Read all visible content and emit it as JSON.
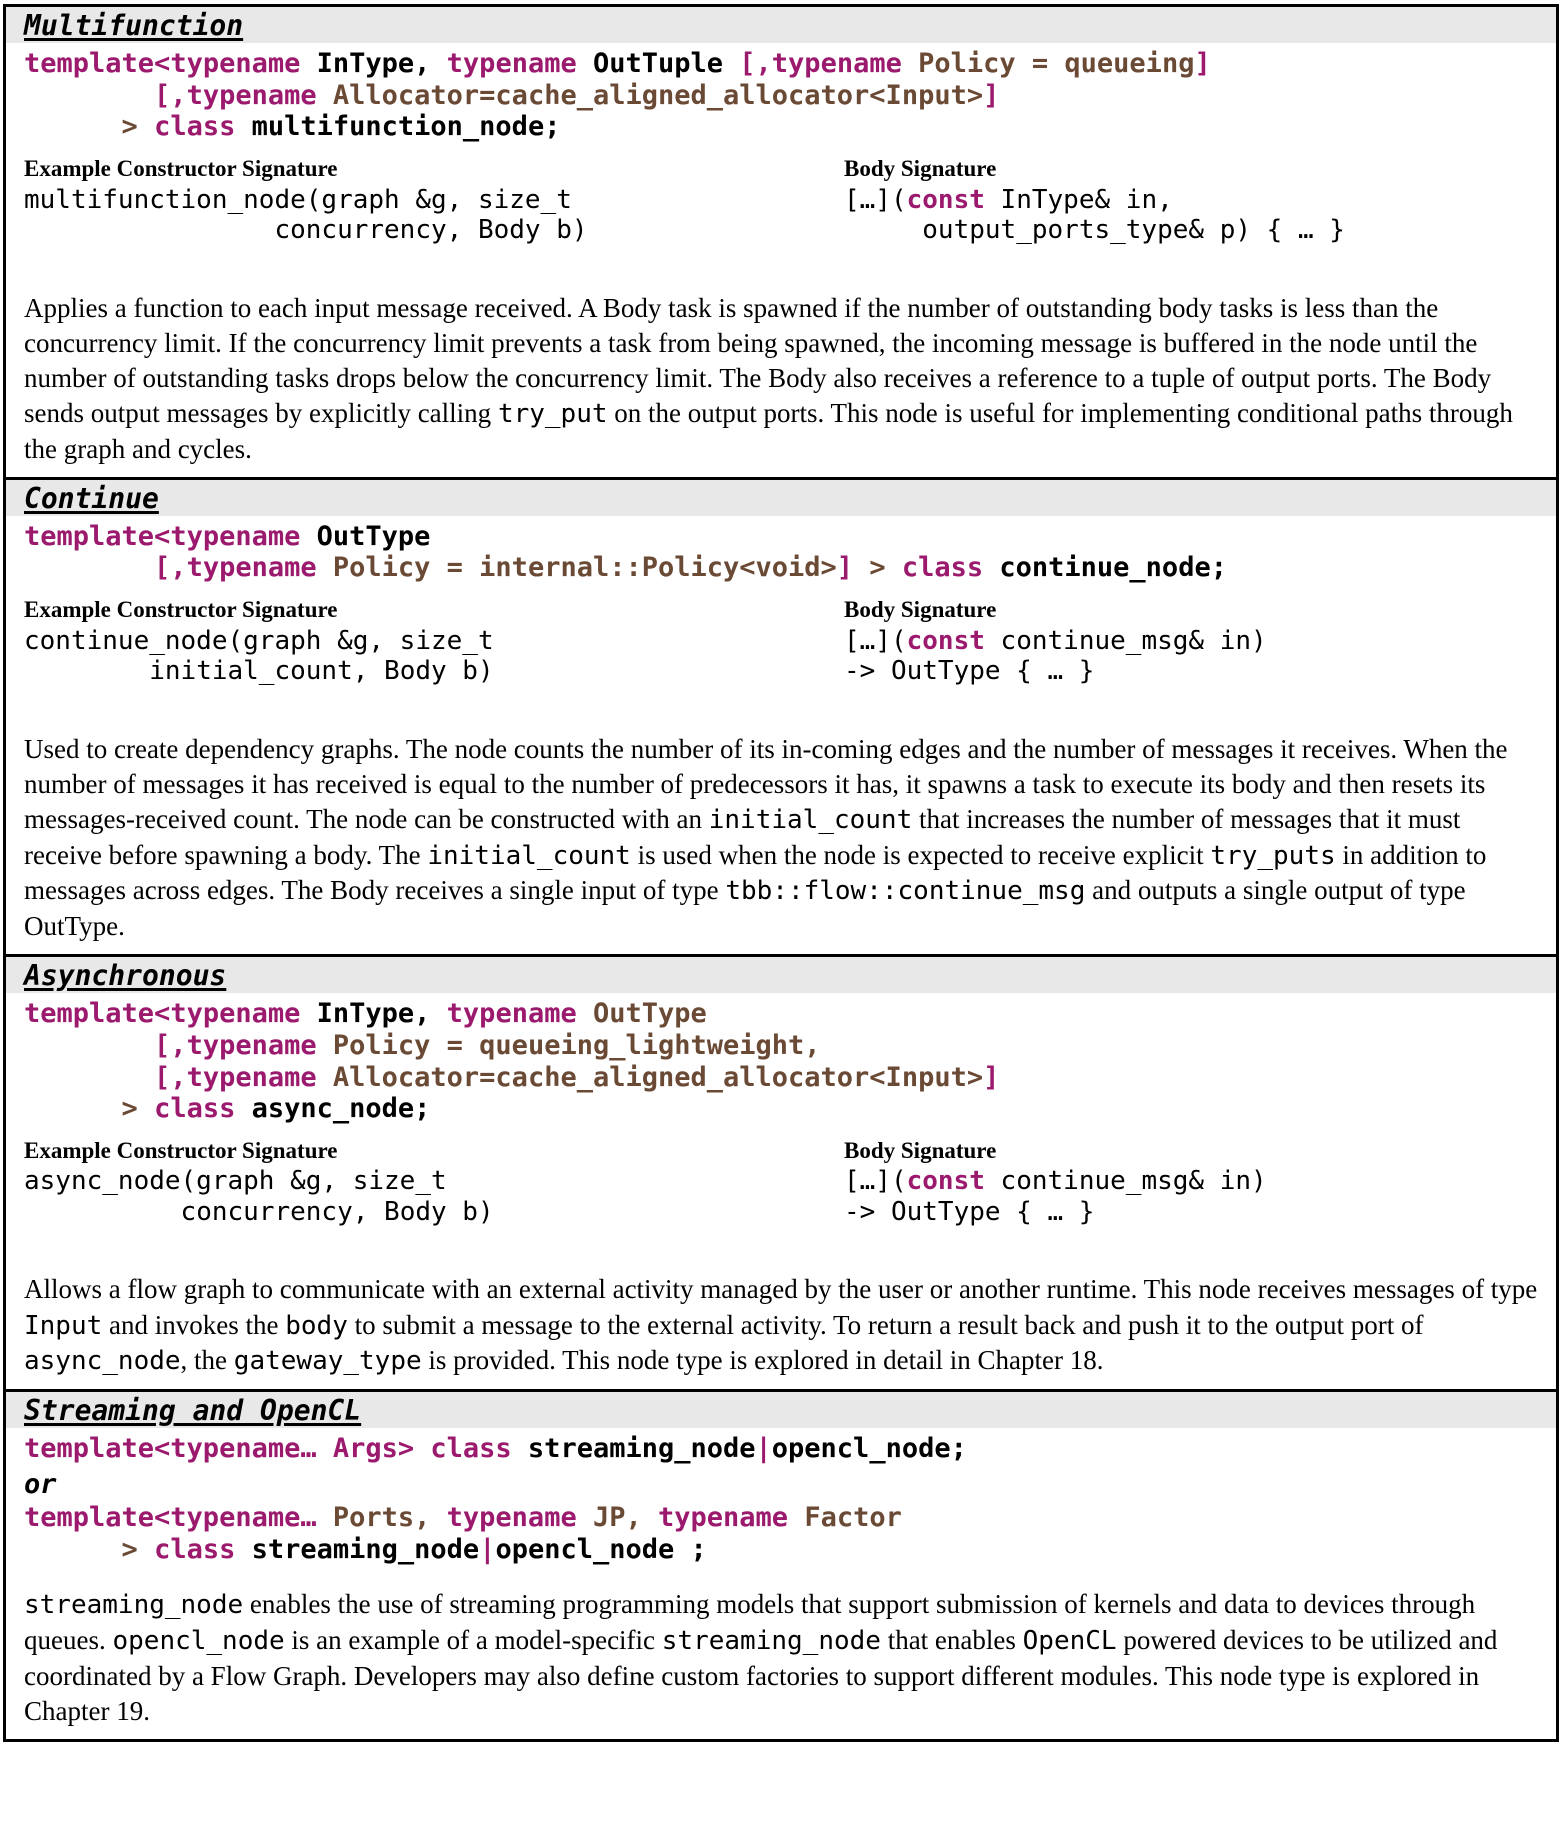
{
  "document": {
    "kind": "reference-table",
    "colors": {
      "keyword": "#9c1a6e",
      "default_value": "#6b4a35",
      "plain": "#000000",
      "header_band": "#e8e8e8",
      "border": "#000000"
    },
    "labels": {
      "constructor_signature": "Example Constructor Signature",
      "body_signature": "Body Signature",
      "or_separator": "or"
    }
  },
  "sections": [
    {
      "id": "multifunction",
      "title": "Multifunction",
      "template": {
        "lines": [
          [
            {
              "t": "template<",
              "c": "kw"
            },
            {
              "t": "typename",
              "c": "kw"
            },
            {
              "t": " InType, ",
              "c": "blk"
            },
            {
              "t": "typename",
              "c": "kw"
            },
            {
              "t": " OutTuple ",
              "c": "blk"
            },
            {
              "t": "[,",
              "c": "kw"
            },
            {
              "t": "typename",
              "c": "kw"
            },
            {
              "t": " ",
              "c": "blk"
            },
            {
              "t": "Policy = queueing",
              "c": "brn"
            },
            {
              "t": "]",
              "c": "kw"
            }
          ],
          [
            {
              "t": "        ",
              "c": "blk"
            },
            {
              "t": "[,",
              "c": "kw"
            },
            {
              "t": "typename",
              "c": "kw"
            },
            {
              "t": " ",
              "c": "blk"
            },
            {
              "t": "Allocator=cache_aligned_allocator<Input>",
              "c": "brn"
            },
            {
              "t": "]",
              "c": "kw"
            }
          ],
          [
            {
              "t": "      > ",
              "c": "brn"
            },
            {
              "t": "class",
              "c": "kw"
            },
            {
              "t": " multifunction_node;",
              "c": "blk"
            }
          ]
        ]
      },
      "constructor_signature": {
        "lines": [
          [
            {
              "t": "multifunction_node(graph &g, size_t",
              "c": "blk"
            }
          ],
          [
            {
              "t": "                concurrency, Body b)",
              "c": "blk"
            }
          ]
        ]
      },
      "body_signature": {
        "lines": [
          [
            {
              "t": "[…](",
              "c": "blk"
            },
            {
              "t": "const",
              "c": "kw"
            },
            {
              "t": " InType& in,",
              "c": "blk"
            }
          ],
          [
            {
              "t": "     output_ports_type& p) { … }",
              "c": "blk"
            }
          ]
        ]
      },
      "description": [
        {
          "t": "Applies a function to each input message received. A Body task is spawned if the number of outstanding body tasks is less than the concurrency limit.   If the concurrency limit prevents a task from being spawned, the incoming message is buffered in the node until the number of outstanding tasks drops below the concurrency limit. The Body also receives a reference to a tuple of output ports. The Body sends output messages by explicitly calling ",
          "m": false
        },
        {
          "t": "try_put",
          "m": true
        },
        {
          "t": "  on the output ports. This node is useful for implementing conditional paths through the graph and cycles.",
          "m": false
        }
      ]
    },
    {
      "id": "continue",
      "title": "Continue",
      "template": {
        "lines": [
          [
            {
              "t": "template<",
              "c": "kw"
            },
            {
              "t": "typename",
              "c": "kw"
            },
            {
              "t": " OutType",
              "c": "blk"
            }
          ],
          [
            {
              "t": "        ",
              "c": "blk"
            },
            {
              "t": "[,",
              "c": "kw"
            },
            {
              "t": "typename",
              "c": "kw"
            },
            {
              "t": " ",
              "c": "blk"
            },
            {
              "t": "Policy = internal::Policy<void>",
              "c": "brn"
            },
            {
              "t": "]",
              "c": "kw"
            },
            {
              "t": " > ",
              "c": "brn"
            },
            {
              "t": "class",
              "c": "kw"
            },
            {
              "t": " continue_node;",
              "c": "blk"
            }
          ]
        ]
      },
      "constructor_signature": {
        "lines": [
          [
            {
              "t": "continue_node(graph &g, size_t",
              "c": "blk"
            }
          ],
          [
            {
              "t": "        initial_count, Body b)",
              "c": "blk"
            }
          ]
        ]
      },
      "body_signature": {
        "lines": [
          [
            {
              "t": "[…](",
              "c": "blk"
            },
            {
              "t": "const",
              "c": "kw"
            },
            {
              "t": " continue_msg& in)",
              "c": "blk"
            }
          ],
          [
            {
              "t": "-> OutType { … }",
              "c": "blk"
            }
          ]
        ]
      },
      "description": [
        {
          "t": "Used to create dependency graphs. The node counts the number of its in-coming edges and the number of messages it receives.   When the number of messages it has received is equal to the number of predecessors it has, it spawns a task to execute its body and then resets its messages-received count. The node can be constructed with an ",
          "m": false
        },
        {
          "t": "initial_count",
          "m": true
        },
        {
          "t": " that increases the number of messages that it must receive before spawning a body.   The ",
          "m": false
        },
        {
          "t": "initial_count",
          "m": true
        },
        {
          "t": " is used when the node is expected to receive explicit ",
          "m": false
        },
        {
          "t": "try_puts",
          "m": true
        },
        {
          "t": " in addition to messages across edges. The Body receives a single input of type ",
          "m": false
        },
        {
          "t": "tbb::flow::continue_msg",
          "m": true
        },
        {
          "t": " and outputs a single output of type OutType.",
          "m": false
        }
      ]
    },
    {
      "id": "asynchronous",
      "title": "Asynchronous",
      "template": {
        "lines": [
          [
            {
              "t": "template<",
              "c": "kw"
            },
            {
              "t": "typename",
              "c": "kw"
            },
            {
              "t": " InType, ",
              "c": "blk"
            },
            {
              "t": "typename",
              "c": "kw"
            },
            {
              "t": " ",
              "c": "blk"
            },
            {
              "t": "OutType",
              "c": "brn"
            }
          ],
          [
            {
              "t": "        ",
              "c": "blk"
            },
            {
              "t": "[,",
              "c": "kw"
            },
            {
              "t": "typename",
              "c": "kw"
            },
            {
              "t": " ",
              "c": "blk"
            },
            {
              "t": "Policy = queueing_lightweight,",
              "c": "brn"
            }
          ],
          [
            {
              "t": "        ",
              "c": "blk"
            },
            {
              "t": "[,",
              "c": "kw"
            },
            {
              "t": "typename",
              "c": "kw"
            },
            {
              "t": " ",
              "c": "blk"
            },
            {
              "t": "Allocator=cache_aligned_allocator<Input>",
              "c": "brn"
            },
            {
              "t": "]",
              "c": "kw"
            }
          ],
          [
            {
              "t": "      > ",
              "c": "brn"
            },
            {
              "t": "class",
              "c": "kw"
            },
            {
              "t": " async_node;",
              "c": "blk"
            }
          ]
        ]
      },
      "constructor_signature": {
        "lines": [
          [
            {
              "t": "async_node(graph &g, size_t",
              "c": "blk"
            }
          ],
          [
            {
              "t": "          concurrency, Body b)",
              "c": "blk"
            }
          ]
        ]
      },
      "body_signature": {
        "lines": [
          [
            {
              "t": "[…](",
              "c": "blk"
            },
            {
              "t": "const",
              "c": "kw"
            },
            {
              "t": " continue_msg& in)",
              "c": "blk"
            }
          ],
          [
            {
              "t": "-> OutType { … }",
              "c": "blk"
            }
          ]
        ]
      },
      "description": [
        {
          "t": "Allows a flow graph to communicate with an external activity managed by the user or another runtime. This node receives messages of type ",
          "m": false
        },
        {
          "t": "Input",
          "m": true
        },
        {
          "t": " and invokes the ",
          "m": false
        },
        {
          "t": "body",
          "m": true
        },
        {
          "t": " to submit a message to the external activity. To return a result back and push it to the output port of ",
          "m": false
        },
        {
          "t": "async_node",
          "m": true
        },
        {
          "t": ", the ",
          "m": false
        },
        {
          "t": "gateway_type",
          "m": true
        },
        {
          "t": " is provided. This node type is explored in detail in Chapter 18.",
          "m": false
        }
      ]
    },
    {
      "id": "streaming-opencl",
      "title": "Streaming and OpenCL",
      "template": {
        "lines": [
          [
            {
              "t": "template<typename… Args> class",
              "c": "kw"
            },
            {
              "t": " streaming_node",
              "c": "blk"
            },
            {
              "t": "|",
              "c": "kw"
            },
            {
              "t": "opencl_node;",
              "c": "blk"
            }
          ]
        ]
      },
      "or_text": "or",
      "template2": {
        "lines": [
          [
            {
              "t": "template<typename… ",
              "c": "kw"
            },
            {
              "t": "Ports",
              "c": "brn"
            },
            {
              "t": ", ",
              "c": "brn"
            },
            {
              "t": "typename",
              "c": "kw"
            },
            {
              "t": " ",
              "c": "blk"
            },
            {
              "t": "JP",
              "c": "brn"
            },
            {
              "t": ", ",
              "c": "brn"
            },
            {
              "t": "typename",
              "c": "kw"
            },
            {
              "t": " ",
              "c": "blk"
            },
            {
              "t": "Factor",
              "c": "brn"
            }
          ],
          [
            {
              "t": "      > ",
              "c": "brn"
            },
            {
              "t": "class",
              "c": "kw"
            },
            {
              "t": " streaming_node",
              "c": "blk"
            },
            {
              "t": "|",
              "c": "kw"
            },
            {
              "t": "opencl_node ;",
              "c": "blk"
            }
          ]
        ]
      },
      "description": [
        {
          "t": "streaming_node",
          "m": true
        },
        {
          "t": " enables the use of streaming programming models that support submission of kernels and data to devices through queues. ",
          "m": false
        },
        {
          "t": "opencl_node",
          "m": true
        },
        {
          "t": " is an example of a model-specific ",
          "m": false
        },
        {
          "t": "streaming_node",
          "m": true
        },
        {
          "t": " that enables ",
          "m": false
        },
        {
          "t": "OpenCL",
          "m": true
        },
        {
          "t": " powered devices to be utilized and coordinated by a Flow Graph. Developers may also define custom factories to support different modules. This node type is explored in Chapter 19.",
          "m": false
        }
      ]
    }
  ]
}
